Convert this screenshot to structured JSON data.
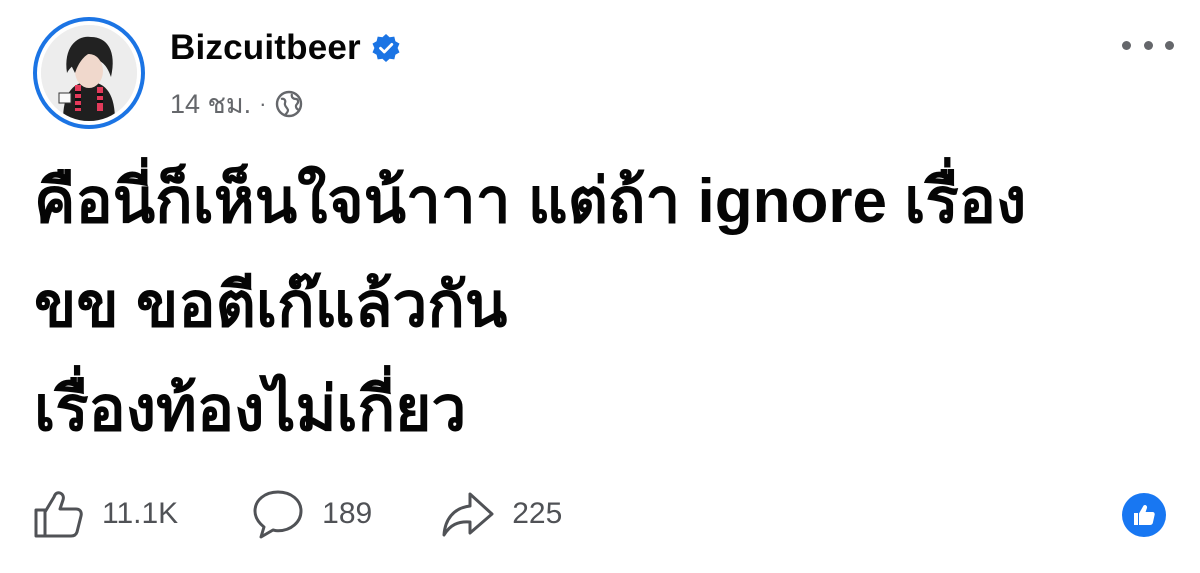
{
  "author": {
    "name": "Bizcuitbeer",
    "verified": true,
    "time": "14 ชม.",
    "separator": "·",
    "audience_icon": "globe-icon"
  },
  "post": {
    "text": "คือนี่ก็เห็นใจน้าาา แต่ถ้า ignore เรื่อง\nขข ขอตีเก๊แล้วกัน\nเรื่องท้องไม่เกี่ยว"
  },
  "actions": {
    "like": {
      "icon": "thumbs-up-icon",
      "count": "11.1K"
    },
    "comment": {
      "icon": "comment-icon",
      "count": "189"
    },
    "share": {
      "icon": "share-arrow-icon",
      "count": "225"
    }
  },
  "reaction_badge": {
    "icon": "like-reaction-icon"
  },
  "colors": {
    "accent": "#1b74e4",
    "text": "#050505",
    "secondary": "#65676b",
    "reaction": "#1877f2"
  }
}
